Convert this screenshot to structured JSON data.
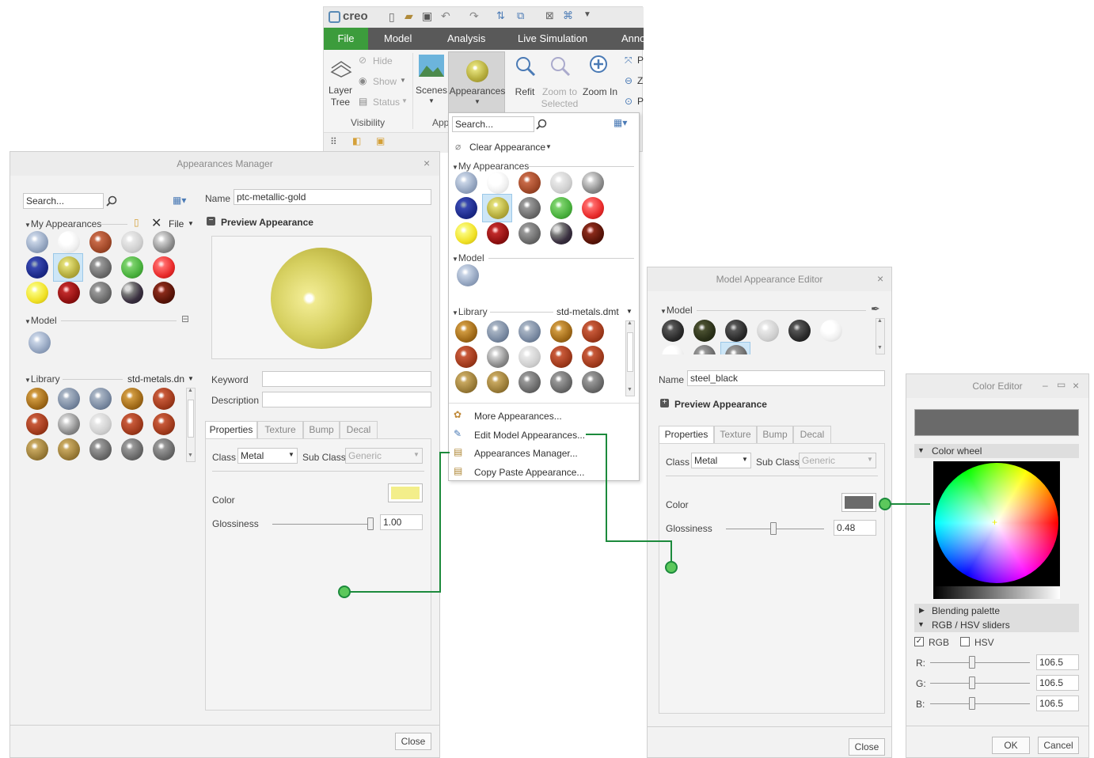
{
  "ribbon": {
    "logo": "creo",
    "tabs": [
      "File",
      "Model",
      "Analysis",
      "Live Simulation",
      "Anno"
    ],
    "layer_tree": [
      "Layer",
      "Tree"
    ],
    "hide": "Hide",
    "show": "Show",
    "status": "Status",
    "visibility": "Visibility",
    "scenes": "Scenes",
    "appearances": "Appearances",
    "app_group": "App",
    "refit": "Refit",
    "zoom_to_selected": [
      "Zoom to",
      "Selected"
    ],
    "zoom_in": "Zoom In",
    "partial": [
      "P",
      "Z",
      "P"
    ]
  },
  "dropdown": {
    "search_placeholder": "Search...",
    "clear_appearance": "Clear Appearance",
    "my_appearances": "My Appearances",
    "model": "Model",
    "library": "Library",
    "library_file": "std-metals.dmt",
    "menu": [
      "More Appearances...",
      "Edit Model Appearances...",
      "Appearances Manager...",
      "Copy Paste Appearance..."
    ]
  },
  "manager": {
    "title": "Appearances Manager",
    "search_placeholder": "Search...",
    "name_label": "Name",
    "name_value": "ptc-metallic-gold",
    "my_appearances": "My Appearances",
    "file": "File",
    "preview": "Preview Appearance",
    "model": "Model",
    "library": "Library",
    "library_file": "std-metals.dn",
    "keyword": "Keyword",
    "description": "Description",
    "tabs": [
      "Properties",
      "Texture",
      "Bump",
      "Decal"
    ],
    "class_label": "Class",
    "class_value": "Metal",
    "subclass_label": "Sub Class",
    "subclass_value": "Generic",
    "color_label": "Color",
    "glossiness_label": "Glossiness",
    "glossiness_value": "1.00",
    "glossiness_level": 1.0,
    "close": "Close",
    "color_hex": "#f3ee8a"
  },
  "editor": {
    "title": "Model Appearance Editor",
    "model": "Model",
    "name_label": "Name",
    "name_value": "steel_black",
    "preview": "Preview Appearance",
    "tabs": [
      "Properties",
      "Texture",
      "Bump",
      "Decal"
    ],
    "class_label": "Class",
    "class_value": "Metal",
    "subclass_label": "Sub Class",
    "subclass_value": "Generic",
    "color_label": "Color",
    "glossiness_label": "Glossiness",
    "glossiness_value": "0.48",
    "glossiness_level": 0.48,
    "close": "Close",
    "color_hex": "#6a6a6a"
  },
  "color_editor": {
    "title": "Color Editor",
    "color_wheel": "Color wheel",
    "blending_palette": "Blending palette",
    "rgb_hsv": "RGB / HSV sliders",
    "rgb": "RGB",
    "hsv": "HSV",
    "r_label": "R:",
    "g_label": "G:",
    "b_label": "B:",
    "r_value": "106.5",
    "g_value": "106.5",
    "b_value": "106.5",
    "ok": "OK",
    "cancel": "Cancel",
    "swatch_hex": "#6a6a6a"
  },
  "colors": {
    "file_tab_green": "#3c9c3c",
    "callout_green": "#1c8a3c"
  }
}
